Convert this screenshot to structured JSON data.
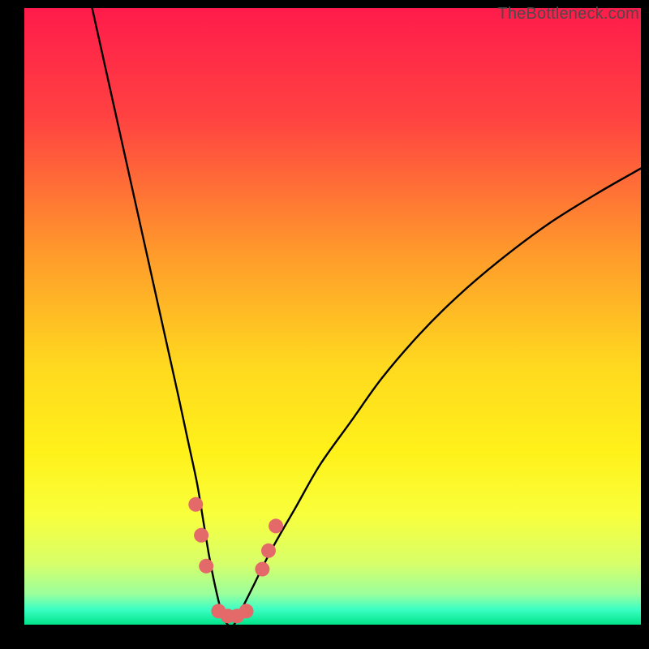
{
  "watermark": "TheBottleneck.com",
  "chart_data": {
    "type": "line",
    "title": "",
    "xlabel": "",
    "ylabel": "",
    "xlim": [
      0,
      100
    ],
    "ylim": [
      0,
      100
    ],
    "grid": false,
    "legend": false,
    "gradient_stops": [
      {
        "offset": 0.0,
        "color": "#ff1b4b"
      },
      {
        "offset": 0.18,
        "color": "#ff4341"
      },
      {
        "offset": 0.4,
        "color": "#ff9b2b"
      },
      {
        "offset": 0.58,
        "color": "#ffd91f"
      },
      {
        "offset": 0.72,
        "color": "#fff11a"
      },
      {
        "offset": 0.82,
        "color": "#f9ff3b"
      },
      {
        "offset": 0.9,
        "color": "#d8ff69"
      },
      {
        "offset": 0.95,
        "color": "#9bff9c"
      },
      {
        "offset": 0.975,
        "color": "#3dffc4"
      },
      {
        "offset": 1.0,
        "color": "#00e48a"
      }
    ],
    "series": [
      {
        "name": "bottleneck-curve",
        "color": "#000000",
        "x": [
          11,
          13,
          15,
          17,
          19,
          21,
          23,
          25,
          26.5,
          28,
          29,
          30,
          31,
          32,
          33,
          34,
          35,
          37,
          40,
          44,
          48,
          53,
          58,
          64,
          70,
          77,
          85,
          93,
          100
        ],
        "y": [
          100,
          91,
          82,
          73,
          64,
          55,
          46,
          37,
          30,
          23,
          17,
          11,
          6,
          2,
          0,
          0,
          2,
          6,
          12,
          19,
          26,
          33,
          40,
          47,
          53,
          59,
          65,
          70,
          74
        ]
      }
    ],
    "markers": {
      "name": "highlight-dots",
      "color": "#e46a6a",
      "radius_px": 9,
      "points": [
        {
          "x": 27.8,
          "y": 19.5
        },
        {
          "x": 28.7,
          "y": 14.5
        },
        {
          "x": 29.5,
          "y": 9.5
        },
        {
          "x": 31.5,
          "y": 2.2
        },
        {
          "x": 33.0,
          "y": 1.4
        },
        {
          "x": 34.5,
          "y": 1.4
        },
        {
          "x": 36.0,
          "y": 2.2
        },
        {
          "x": 38.6,
          "y": 9.0
        },
        {
          "x": 39.6,
          "y": 12.0
        },
        {
          "x": 40.8,
          "y": 16.0
        }
      ]
    }
  }
}
